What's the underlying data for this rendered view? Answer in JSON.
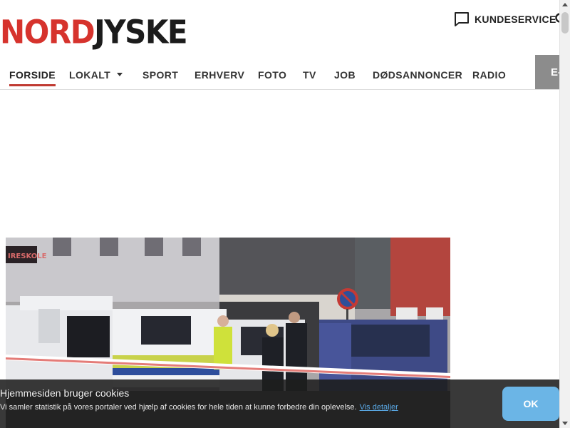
{
  "header": {
    "logo_part1": "NORD",
    "logo_part2": "JYSKE",
    "kundeservice_label": "KUNDESERVICE"
  },
  "nav": {
    "items": [
      {
        "label": "FORSIDE",
        "active": true
      },
      {
        "label": "LOKALT",
        "dropdown": true
      },
      {
        "label": "SPORT"
      },
      {
        "label": "ERHVERV"
      },
      {
        "label": "FOTO"
      },
      {
        "label": "TV"
      },
      {
        "label": "JOB"
      },
      {
        "label": "DØDSANNONCER"
      },
      {
        "label": "RADIO"
      }
    ],
    "extra_button": "E-"
  },
  "photo": {
    "shop_sign": "IRESKOLE"
  },
  "cookie_banner": {
    "title": "Hjemmesiden bruger cookies",
    "text": "Vi samler statistik på vores portaler ved hjælp af cookies for hele tiden at kunne forbedre din oplevelse.",
    "link": "Vis detaljer",
    "ok_label": "OK"
  },
  "colors": {
    "brand_red": "#d6332d",
    "active_underline": "#c03a31",
    "ok_button": "#6bb5e6",
    "link": "#5aa9e6"
  }
}
